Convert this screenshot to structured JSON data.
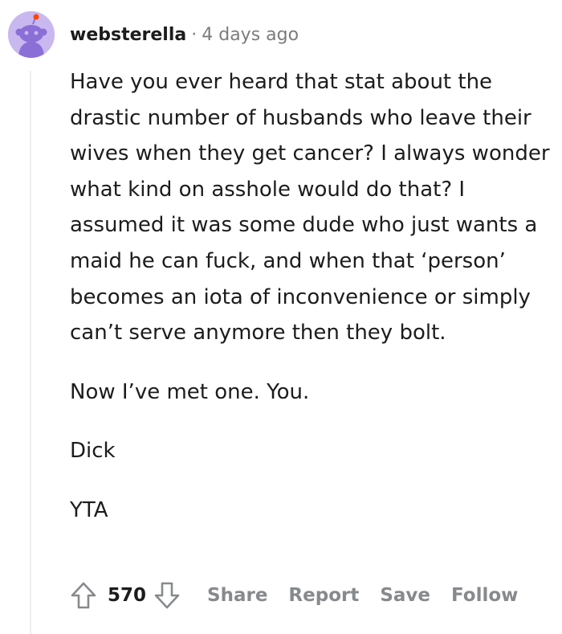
{
  "comment": {
    "username": "websterella",
    "separator": "·",
    "time_ago": "4 days ago",
    "paragraphs": [
      "Have you ever heard that stat about the drastic number of husbands who leave their wives when they get cancer? I always wonder what kind on asshole would do that? I assumed it was some dude who just wants a maid he can fuck, and when that ‘person’ becomes an iota of inconvenience or simply can’t serve anymore then they bolt.",
      "Now I’ve met one. You.",
      "Dick",
      "YTA"
    ],
    "score": "570",
    "actions": {
      "share": "Share",
      "report": "Report",
      "save": "Save",
      "follow": "Follow"
    }
  },
  "colors": {
    "avatar_bg": "#c9b8f0",
    "text": "#1c1c1c",
    "muted": "#7c7c7c",
    "action": "#878a8c",
    "thread_line": "#edeff1"
  }
}
